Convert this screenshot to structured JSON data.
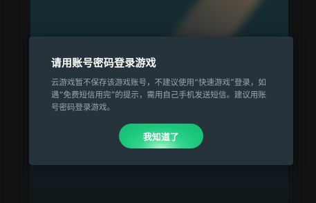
{
  "dialog": {
    "title": "请用账号密码登录游戏",
    "message": "云游戏暂不保存该游戏账号，不建议使用“快速游戏”登录，如遇“免费短信用完”的提示，需用自己手机发送短信。建议用账号密码登录游戏。",
    "confirm_label": "我知道了"
  },
  "colors": {
    "dialog_background": "#27333b",
    "accent": "#1cc77c",
    "title_text": "#ffffff",
    "body_text": "#9aa5ad"
  }
}
